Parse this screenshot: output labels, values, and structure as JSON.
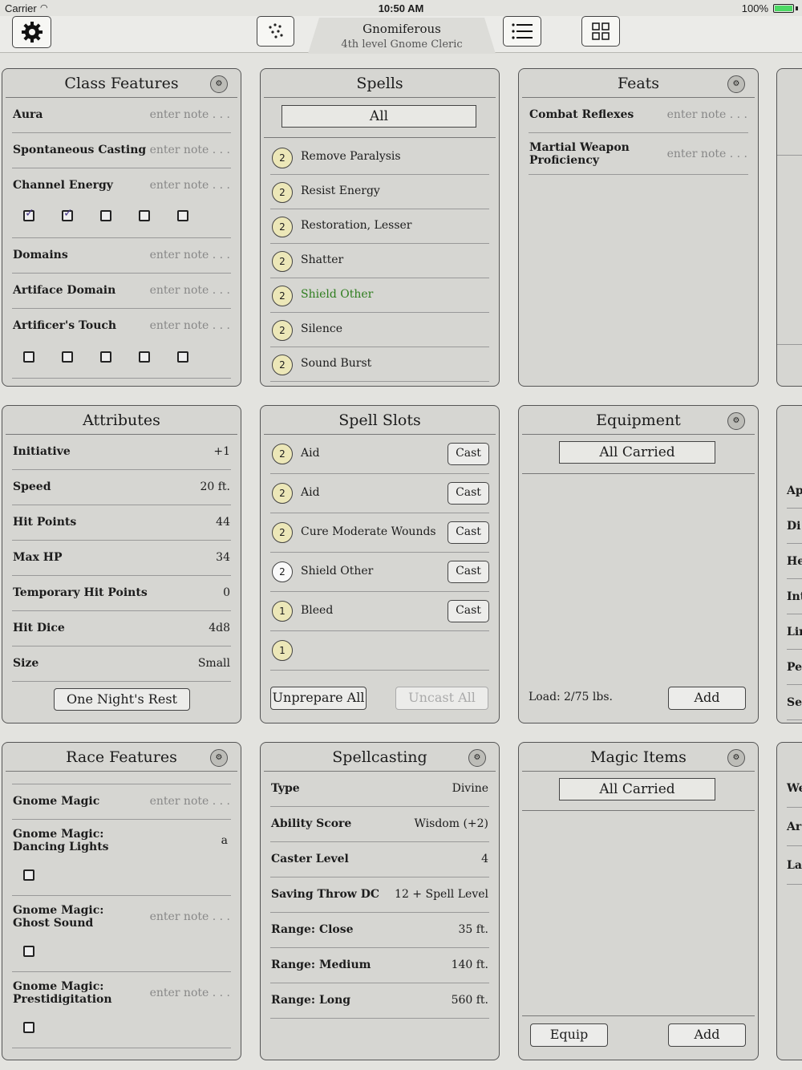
{
  "status": {
    "carrier": "Carrier",
    "time": "10:50 AM",
    "battery": "100%"
  },
  "header": {
    "name": "Gnomiferous",
    "subtitle": "4th level Gnome Cleric"
  },
  "toolbar": {
    "settings_icon": "gear-icon",
    "dice_icon": "dice-icon",
    "list_icon": "list-icon",
    "grid_icon": "grid-icon"
  },
  "class_features": {
    "title": "Class Features",
    "note_placeholder": "enter note . . .",
    "items": [
      "Aura",
      "Spontaneous Casting",
      "Channel Energy",
      "Domains",
      "Artiface Domain",
      "Artificer's Touch"
    ]
  },
  "spells": {
    "title": "Spells",
    "filter": "All",
    "items": [
      {
        "level": "2",
        "name": "Remove Paralysis"
      },
      {
        "level": "2",
        "name": "Resist Energy"
      },
      {
        "level": "2",
        "name": "Restoration, Lesser"
      },
      {
        "level": "2",
        "name": "Shatter"
      },
      {
        "level": "2",
        "name": "Shield Other",
        "highlight": "#2e7d1e"
      },
      {
        "level": "2",
        "name": "Silence"
      },
      {
        "level": "2",
        "name": "Sound Burst"
      }
    ]
  },
  "feats": {
    "title": "Feats",
    "items": [
      "Combat Reflexes",
      "Martial Weapon Proficiency"
    ],
    "item_lines": [
      [
        "Combat Reflexes"
      ],
      [
        "Martial Weapon",
        "Proficiency"
      ]
    ]
  },
  "attributes": {
    "title": "Attributes",
    "rows": [
      {
        "label": "Initiative",
        "value": "+1"
      },
      {
        "label": "Speed",
        "value": "20 ft."
      },
      {
        "label": "Hit Points",
        "value": "44"
      },
      {
        "label": "Max HP",
        "value": "34"
      },
      {
        "label": "Temporary Hit Points",
        "value": "0"
      },
      {
        "label": "Hit Dice",
        "value": "4d8"
      },
      {
        "label": "Size",
        "value": "Small"
      }
    ],
    "rest_button": "One Night's Rest"
  },
  "spell_slots": {
    "title": "Spell Slots",
    "cast_label": "Cast",
    "slots": [
      {
        "level": "2",
        "name": "Aid"
      },
      {
        "level": "2",
        "name": "Aid"
      },
      {
        "level": "2",
        "name": "Cure Moderate Wounds"
      },
      {
        "level": "2",
        "name": "Shield Other"
      },
      {
        "level": "1",
        "name": "Bleed"
      },
      {
        "level": "1",
        "name": ""
      }
    ],
    "unprepare_all": "Unprepare All",
    "uncast_all": "Uncast All"
  },
  "equipment": {
    "title": "Equipment",
    "filter": "All Carried",
    "load_label": "Load:",
    "load_value": "2/75 lbs.",
    "add_label": "Add"
  },
  "race_features": {
    "title": "Race Features",
    "items": [
      {
        "lines": [
          "Gnome Magic"
        ],
        "note": "enter note . . ."
      },
      {
        "lines": [
          "Gnome Magic:",
          "Dancing Lights"
        ],
        "note": "a"
      },
      {
        "lines": [
          "Gnome Magic:",
          "Ghost Sound"
        ],
        "note": "enter note . . ."
      },
      {
        "lines": [
          "Gnome Magic:",
          "Prestidigitation"
        ],
        "note": "enter note . . ."
      }
    ]
  },
  "spellcasting": {
    "title": "Spellcasting",
    "rows": [
      {
        "label": "Type",
        "value": "Divine"
      },
      {
        "label": "Ability Score",
        "value": "Wisdom (+2)"
      },
      {
        "label": "Caster Level",
        "value": "4"
      },
      {
        "label": "Saving Throw DC",
        "value": "12 + Spell Level"
      },
      {
        "label": "Range: Close",
        "value": "35 ft."
      },
      {
        "label": "Range: Medium",
        "value": "140 ft."
      },
      {
        "label": "Range: Long",
        "value": "560 ft."
      }
    ]
  },
  "magic_items": {
    "title": "Magic Items",
    "filter": "All Carried",
    "equip_label": "Equip",
    "add_label": "Add"
  },
  "right_column_partial": {
    "row2": [
      "Ap",
      "Di",
      "He",
      "Int",
      "Lir",
      "Per",
      "Ser"
    ],
    "row3": [
      "We",
      "Ar",
      "La"
    ]
  },
  "colors": {
    "background": "#e3e3df",
    "panel": "#d6d6d2",
    "spell_level_badge": "#ece7b8",
    "highlight_spell": "#2e7d1e"
  }
}
